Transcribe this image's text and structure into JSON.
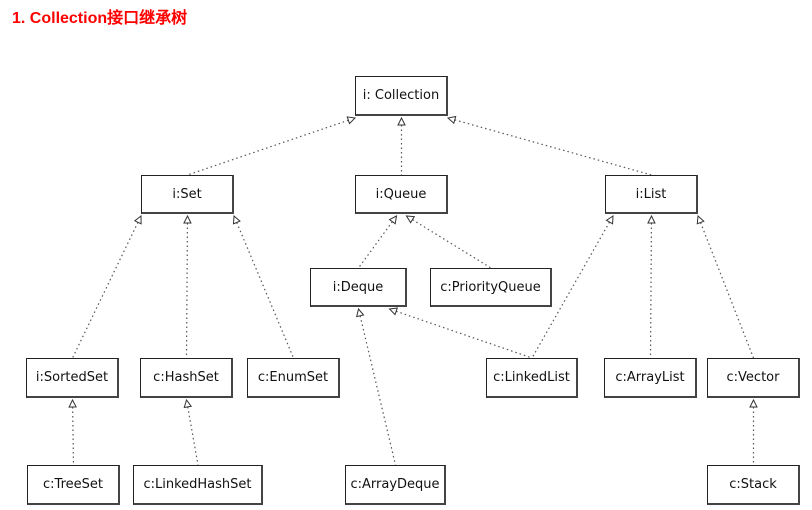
{
  "title": "1. Collection接口继承树",
  "colors": {
    "title": "#ff0000",
    "edge": "#555555",
    "box_border": "#222222"
  },
  "nodes": [
    {
      "id": "collection",
      "label": "i: Collection",
      "kind": "interface"
    },
    {
      "id": "set",
      "label": "i:Set",
      "kind": "interface"
    },
    {
      "id": "queue",
      "label": "i:Queue",
      "kind": "interface"
    },
    {
      "id": "list",
      "label": "i:List",
      "kind": "interface"
    },
    {
      "id": "deque",
      "label": "i:Deque",
      "kind": "interface"
    },
    {
      "id": "priorityqueue",
      "label": "c:PriorityQueue",
      "kind": "class"
    },
    {
      "id": "sortedset",
      "label": "i:SortedSet",
      "kind": "interface"
    },
    {
      "id": "hashset",
      "label": "c:HashSet",
      "kind": "class"
    },
    {
      "id": "enumset",
      "label": "c:EnumSet",
      "kind": "class"
    },
    {
      "id": "linkedlist",
      "label": "c:LinkedList",
      "kind": "class"
    },
    {
      "id": "arraylist",
      "label": "c:ArrayList",
      "kind": "class"
    },
    {
      "id": "vector",
      "label": "c:Vector",
      "kind": "class"
    },
    {
      "id": "treeset",
      "label": "c:TreeSet",
      "kind": "class"
    },
    {
      "id": "linkedhashset",
      "label": "c:LinkedHashSet",
      "kind": "class"
    },
    {
      "id": "arraydeque",
      "label": "c:ArrayDeque",
      "kind": "class"
    },
    {
      "id": "stack",
      "label": "c:Stack",
      "kind": "class"
    }
  ],
  "edges": [
    {
      "from": "set",
      "to": "collection"
    },
    {
      "from": "queue",
      "to": "collection"
    },
    {
      "from": "list",
      "to": "collection"
    },
    {
      "from": "sortedset",
      "to": "set"
    },
    {
      "from": "hashset",
      "to": "set"
    },
    {
      "from": "enumset",
      "to": "set"
    },
    {
      "from": "deque",
      "to": "queue"
    },
    {
      "from": "priorityqueue",
      "to": "queue"
    },
    {
      "from": "linkedlist",
      "to": "deque"
    },
    {
      "from": "linkedlist",
      "to": "list"
    },
    {
      "from": "arraylist",
      "to": "list"
    },
    {
      "from": "vector",
      "to": "list"
    },
    {
      "from": "treeset",
      "to": "sortedset"
    },
    {
      "from": "linkedhashset",
      "to": "hashset"
    },
    {
      "from": "arraydeque",
      "to": "deque"
    },
    {
      "from": "stack",
      "to": "vector"
    }
  ]
}
